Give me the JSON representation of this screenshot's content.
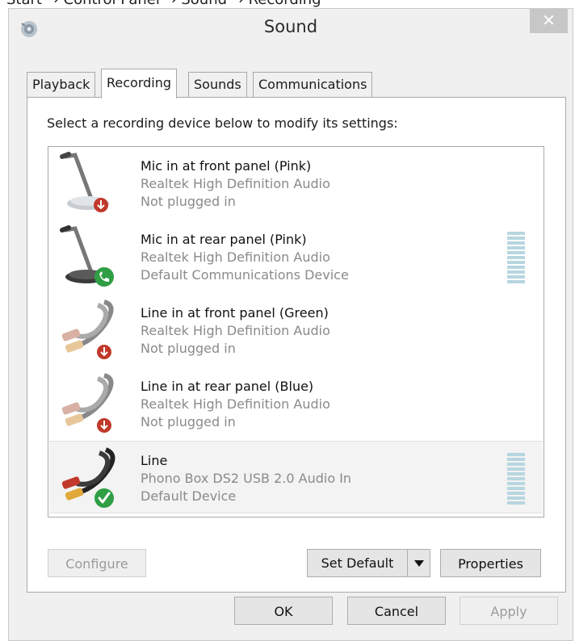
{
  "breadcrumb": "Start → Control Panel → Sound → Recording",
  "window": {
    "title": "Sound",
    "close_glyph": "✕",
    "app_icon": "speaker-icon"
  },
  "tabs": [
    {
      "label": "Playback",
      "active": false
    },
    {
      "label": "Recording",
      "active": true
    },
    {
      "label": "Sounds",
      "active": false
    },
    {
      "label": "Communications",
      "active": false
    }
  ],
  "instruction": "Select a recording device below to modify its settings:",
  "devices": [
    {
      "name": "Mic in at front panel (Pink)",
      "driver": "Realtek High Definition Audio",
      "status": "Not plugged in",
      "icon": "microphone-icon",
      "badge": "unplugged-badge",
      "meter_level": null
    },
    {
      "name": "Mic in at rear panel (Pink)",
      "driver": "Realtek High Definition Audio",
      "status": "Default Communications Device",
      "icon": "microphone-icon",
      "badge": "phone-badge",
      "meter_level": 0
    },
    {
      "name": "Line in at front panel (Green)",
      "driver": "Realtek High Definition Audio",
      "status": "Not plugged in",
      "icon": "rca-cable-icon",
      "badge": "unplugged-badge",
      "meter_level": null
    },
    {
      "name": "Line in at rear panel (Blue)",
      "driver": "Realtek High Definition Audio",
      "status": "Not plugged in",
      "icon": "rca-cable-icon",
      "badge": "unplugged-badge",
      "meter_level": null
    },
    {
      "name": "Line",
      "driver": "Phono Box DS2 USB 2.0 Audio In",
      "status": "Default Device",
      "icon": "rca-cable-icon",
      "badge": "default-check-badge",
      "meter_level": 0,
      "selected": true
    }
  ],
  "buttons": {
    "configure": "Configure",
    "set_default": "Set Default",
    "properties": "Properties",
    "ok": "OK",
    "cancel": "Cancel",
    "apply": "Apply"
  },
  "colors": {
    "meter": "#b7d6e0",
    "unplugged_badge": "#c0392b",
    "default_badge": "#2f9e44",
    "close_button": "#c7c7c7"
  }
}
